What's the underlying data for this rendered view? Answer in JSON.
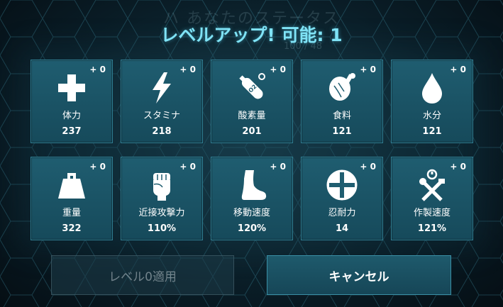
{
  "header": {
    "title": "レベルアップ! 可能: 1",
    "ghost_title": "ハ      あなたのステータス",
    "ghost_subtitle": "100 / 48"
  },
  "stats": [
    {
      "key": "health",
      "label": "体力",
      "value": "237",
      "bonus": "+ 0",
      "icon": "health-cross-icon"
    },
    {
      "key": "stamina",
      "label": "スタミナ",
      "value": "218",
      "bonus": "+ 0",
      "icon": "lightning-bolt-icon"
    },
    {
      "key": "oxygen",
      "label": "酸素量",
      "value": "201",
      "bonus": "+ 0",
      "icon": "oxygen-tank-icon"
    },
    {
      "key": "food",
      "label": "食料",
      "value": "121",
      "bonus": "+ 0",
      "icon": "meat-leg-icon"
    },
    {
      "key": "water",
      "label": "水分",
      "value": "121",
      "bonus": "+ 0",
      "icon": "water-drop-icon"
    },
    {
      "key": "weight",
      "label": "重量",
      "value": "322",
      "bonus": "+ 0",
      "icon": "weight-icon"
    },
    {
      "key": "melee",
      "label": "近接攻撃力",
      "value": "110%",
      "bonus": "+ 0",
      "icon": "fist-icon"
    },
    {
      "key": "movement",
      "label": "移動速度",
      "value": "120%",
      "bonus": "+ 0",
      "icon": "foot-icon"
    },
    {
      "key": "fortitude",
      "label": "忍耐力",
      "value": "14",
      "bonus": "+ 0",
      "icon": "fortitude-shield-icon"
    },
    {
      "key": "crafting",
      "label": "作製速度",
      "value": "121%",
      "bonus": "+ 0",
      "icon": "crafting-tools-icon"
    }
  ],
  "buttons": {
    "apply_label": "レベル0適用",
    "cancel_label": "キャンセル"
  },
  "colors": {
    "title": "#7fe3f6",
    "card": "#1f5d70",
    "card_border": "#2f7d92"
  }
}
